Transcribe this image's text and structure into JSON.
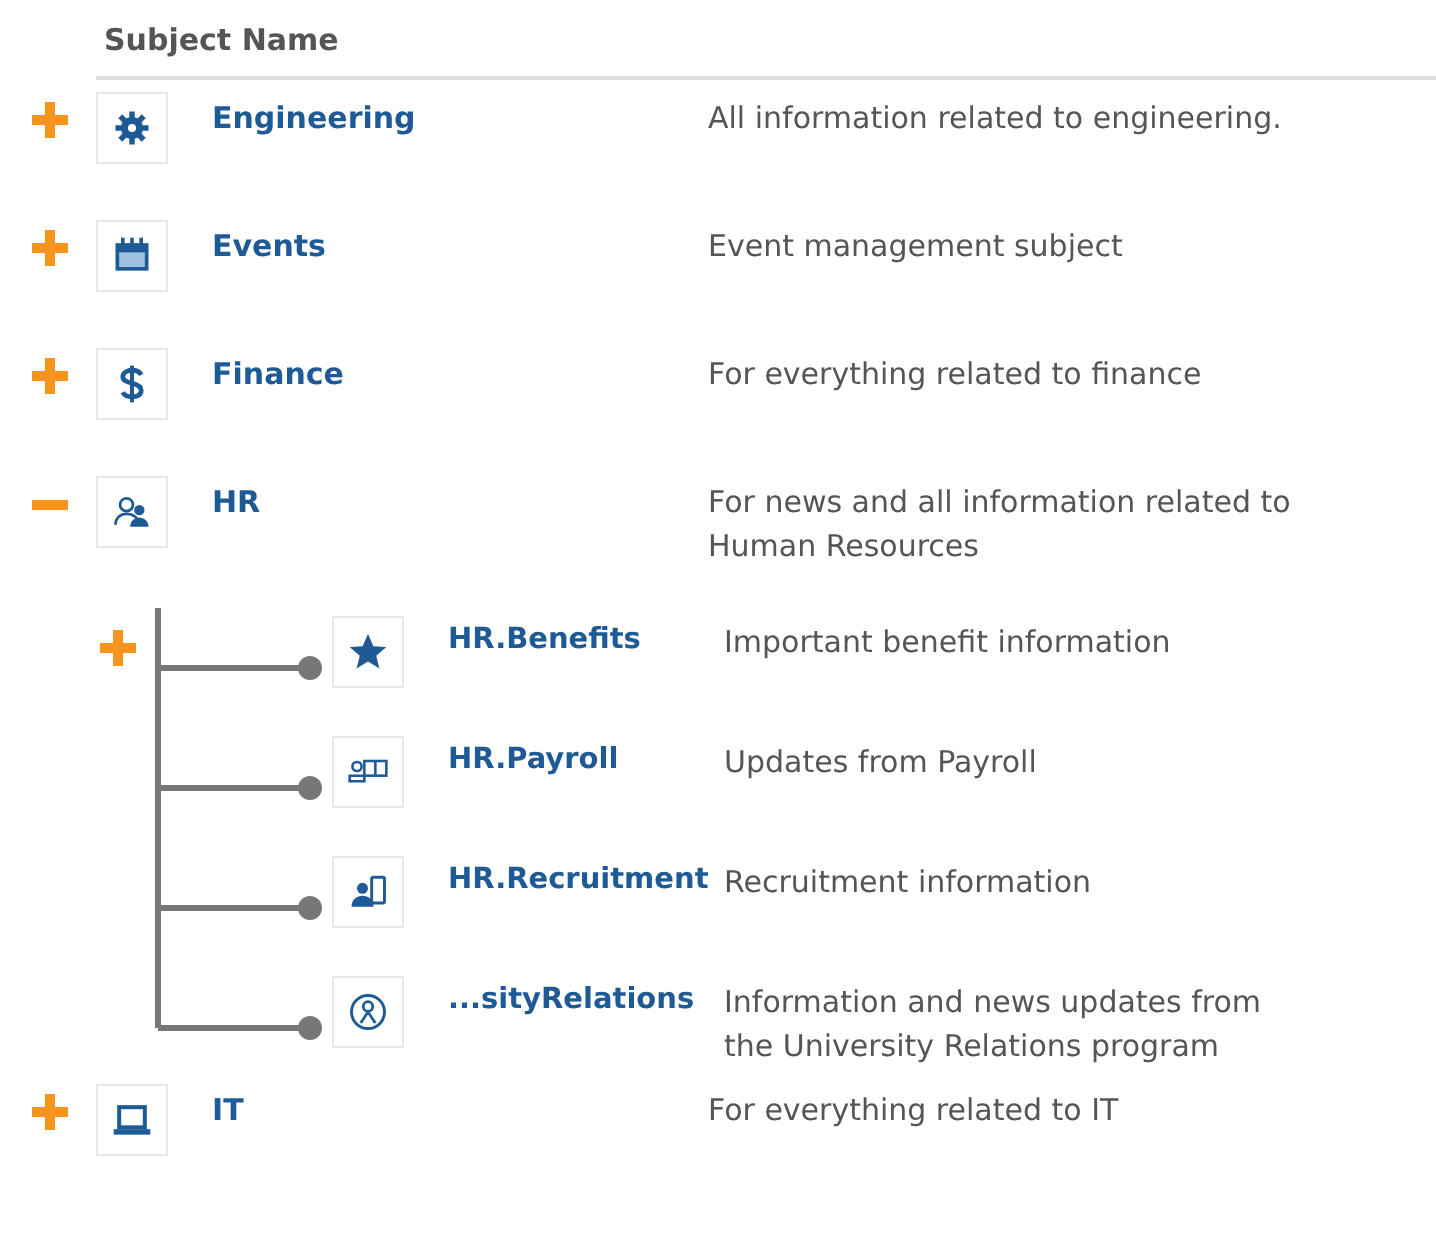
{
  "table": {
    "columns": [
      "Subject Name"
    ],
    "rows": [
      {
        "name": "Engineering",
        "description": "All information related to engineering.",
        "expanded": false
      },
      {
        "name": "Events",
        "description": "Event management subject",
        "expanded": false
      },
      {
        "name": "Finance",
        "description": "For everything related to finance",
        "expanded": false
      },
      {
        "name": "HR",
        "description": "For news and all information related to Human Resources",
        "expanded": true,
        "children": [
          {
            "name": "HR.Benefits",
            "description": "Important benefit information",
            "expanded": false
          },
          {
            "name": "HR.Payroll",
            "description": "Updates from Payroll"
          },
          {
            "name": "HR.Recruitment",
            "description": "Recruitment information"
          },
          {
            "name": "...sityRelations",
            "description": "Information and news updates from the University Relations program"
          }
        ]
      },
      {
        "name": "IT",
        "description": "For everything related to IT",
        "expanded": false
      }
    ]
  }
}
